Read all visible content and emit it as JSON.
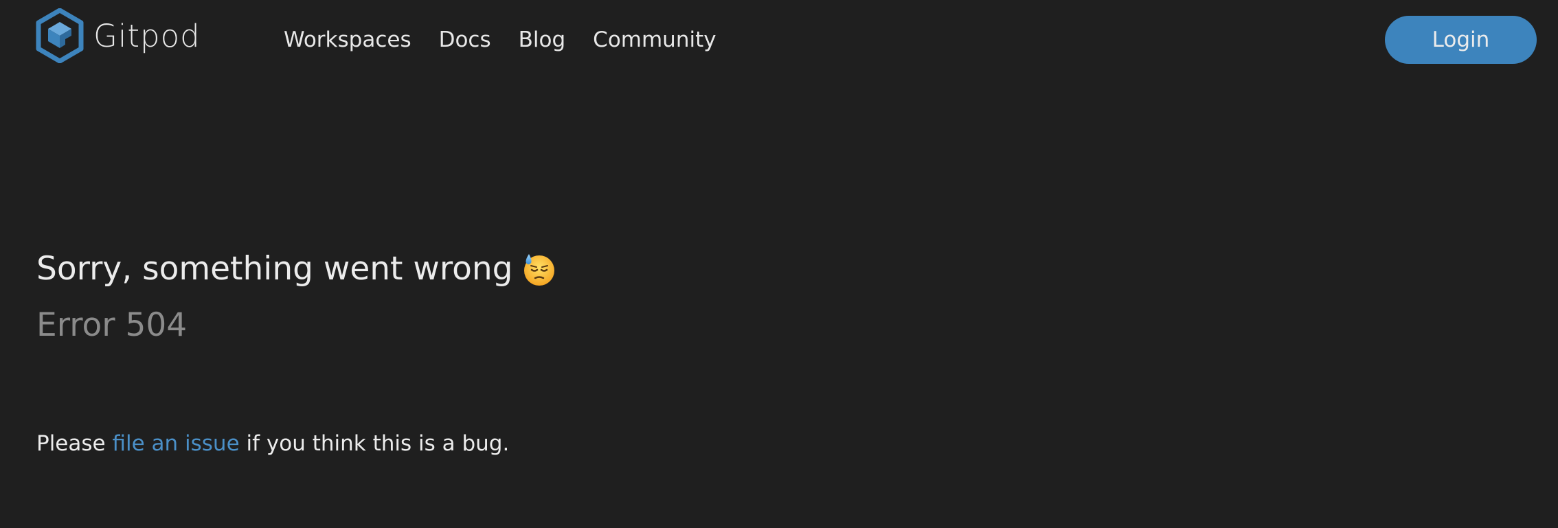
{
  "header": {
    "brand_name": "Gitpod",
    "logo_icon": "gitpod-logo-icon",
    "nav": [
      {
        "label": "Workspaces"
      },
      {
        "label": "Docs"
      },
      {
        "label": "Blog"
      },
      {
        "label": "Community"
      }
    ],
    "login_label": "Login"
  },
  "error": {
    "title": "Sorry, something went wrong",
    "emoji_icon": "downcast-face-with-sweat-icon",
    "code_text": "Error 504"
  },
  "help": {
    "prefix": "Please ",
    "link_label": "file an issue",
    "suffix": " if you think this is a bug."
  },
  "colors": {
    "background": "#1f1f1f",
    "accent": "#3d84bd",
    "link": "#4b90c8",
    "muted": "#8b8b8b",
    "text": "#ececec"
  }
}
